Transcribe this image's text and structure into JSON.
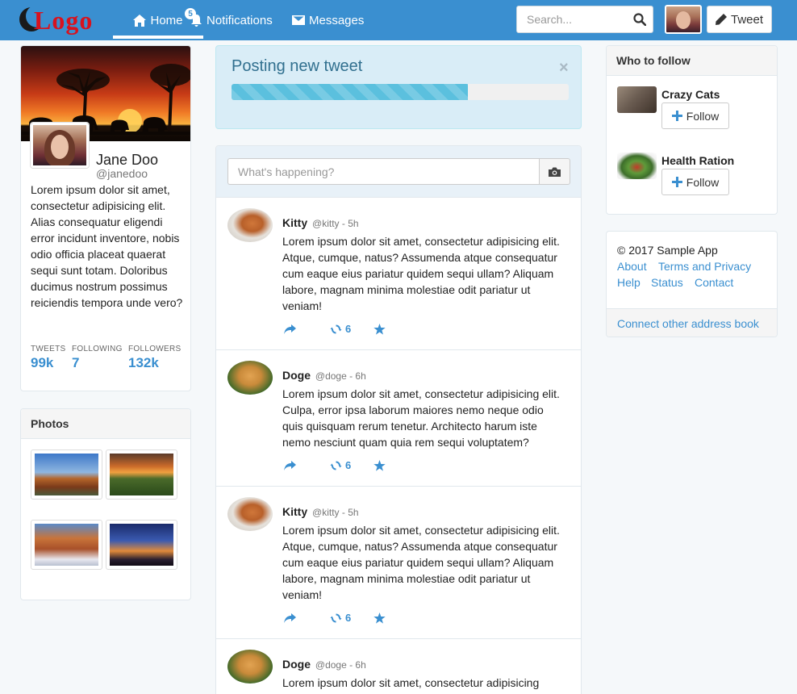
{
  "nav": {
    "logo_text": "Logo",
    "home": "Home",
    "notifications": "Notifications",
    "notifications_count": "5",
    "messages": "Messages",
    "search_placeholder": "Search...",
    "tweet_button": "Tweet"
  },
  "profile": {
    "name": "Jane Doo",
    "handle": "@janedoo",
    "bio": "Lorem ipsum dolor sit amet, consectetur adipisicing elit. Alias consequatur eligendi error incidunt inventore, nobis odio officia placeat quaerat sequi sunt totam. Doloribus ducimus nostrum possimus reiciendis tempora unde vero?",
    "stats": [
      {
        "label": "TWEETS",
        "value": "99k"
      },
      {
        "label": "FOLLOWING",
        "value": "7"
      },
      {
        "label": "FOLLOWERS",
        "value": "132k"
      }
    ]
  },
  "photos": {
    "title": "Photos"
  },
  "posting": {
    "title": "Posting new tweet",
    "close": "×",
    "progress": 0.7
  },
  "compose": {
    "placeholder": "What's happening?"
  },
  "tweets": [
    {
      "author": "Kitty",
      "meta": "@kitty - 5h",
      "body": "Lorem ipsum dolor sit amet, consectetur adipisicing elit. Atque, cumque, natus? Assumenda atque consequatur cum eaque eius pariatur quidem sequi ullam? Aliquam labore, magnam minima molestiae odit pariatur ut veniam!",
      "retweets": "6"
    },
    {
      "author": "Doge",
      "meta": "@doge - 6h",
      "body": "Lorem ipsum dolor sit amet, consectetur adipisicing elit. Culpa, error ipsa laborum maiores nemo neque odio quis quisquam rerum tenetur. Architecto harum iste nemo nesciunt quam quia rem sequi voluptatem?",
      "retweets": "6"
    },
    {
      "author": "Kitty",
      "meta": "@kitty - 5h",
      "body": "Lorem ipsum dolor sit amet, consectetur adipisicing elit. Atque, cumque, natus? Assumenda atque consequatur cum eaque eius pariatur quidem sequi ullam? Aliquam labore, magnam minima molestiae odit pariatur ut veniam!",
      "retweets": "6"
    },
    {
      "author": "Doge",
      "meta": "@doge - 6h",
      "body": "Lorem ipsum dolor sit amet, consectetur adipisicing"
    }
  ],
  "who_to_follow": {
    "title": "Who to follow",
    "items": [
      {
        "name": "Crazy Cats",
        "button": "Follow"
      },
      {
        "name": "Health Ration",
        "button": "Follow"
      }
    ]
  },
  "footer": {
    "copyright": "© 2017 Sample App",
    "links": [
      "About",
      "Terms and Privacy",
      "Help",
      "Status",
      "Contact"
    ],
    "connect": "Connect other address book"
  },
  "colors": {
    "navbar": "#3a8fd0",
    "accent": "#3a8fd0",
    "logo_red": "#d8121e",
    "alert_bg": "#d9edf7",
    "progress": "#5bc0de"
  }
}
